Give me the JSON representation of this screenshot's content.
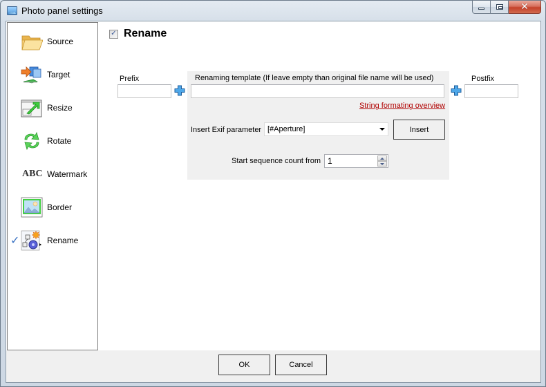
{
  "window": {
    "title": "Photo panel settings",
    "icon": "photo-app-icon",
    "controls": {
      "minimize": "minimize-icon",
      "maximize": "maximize-icon",
      "close": "close-icon"
    }
  },
  "sidebar": {
    "items": [
      {
        "label": "Source",
        "icon": "folder-icon",
        "selected": false
      },
      {
        "label": "Target",
        "icon": "target-network-icon",
        "selected": false
      },
      {
        "label": "Resize",
        "icon": "resize-icon",
        "selected": false
      },
      {
        "label": "Rotate",
        "icon": "rotate-icon",
        "selected": false
      },
      {
        "label": "Watermark",
        "icon": "watermark-abc-icon",
        "icon_text": "ABC",
        "selected": false
      },
      {
        "label": "Border",
        "icon": "border-picture-icon",
        "selected": false
      },
      {
        "label": "Rename",
        "icon": "rename-gear-icon",
        "selected": true
      }
    ],
    "check_glyph": "✓"
  },
  "main": {
    "section_title": "Rename",
    "section_enabled": true,
    "checkbox_glyph": "✓",
    "prefix": {
      "label": "Prefix",
      "value": ""
    },
    "template": {
      "label": "Renaming template (If leave empty than original file name will be used)",
      "value": "",
      "help_link": "String formating overview"
    },
    "postfix": {
      "label": "Postfix",
      "value": ""
    },
    "exif": {
      "label": "Insert Exif parameter",
      "selected": "[#Aperture]",
      "insert_button": "Insert"
    },
    "sequence": {
      "label": "Start sequence count from",
      "value": "1"
    }
  },
  "footer": {
    "ok_label": "OK",
    "cancel_label": "Cancel"
  }
}
